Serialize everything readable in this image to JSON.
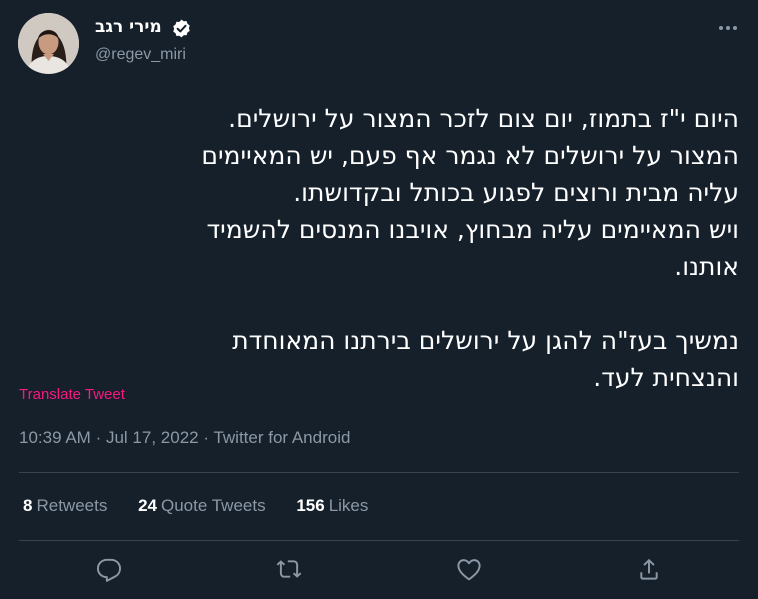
{
  "author": {
    "display_name": "מירי רגב",
    "handle": "@regev_miri",
    "verified": true
  },
  "tweet": {
    "lines": [
      "היום י\"ז בתמוז, יום צום לזכר המצור על ירושלים.",
      "המצור על ירושלים לא נגמר אף פעם, יש המאיימים",
      "עליה מבית ורוצים לפגוע בכותל ובקדושתו.",
      "ויש המאיימים עליה מבחוץ, אויבנו המנסים להשמיד",
      "אותנו.",
      "",
      "נמשיך בעז\"ה להגן על ירושלים בירתנו המאוחדת",
      "והנצחית לעד."
    ],
    "translate_label": "Translate Tweet",
    "time": "10:39 AM",
    "date": "Jul 17, 2022",
    "source": "Twitter for Android",
    "separator": "·"
  },
  "stats": {
    "retweets_count": "8",
    "retweets_label": "Retweets",
    "quote_count": "24",
    "quote_label": "Quote Tweets",
    "likes_count": "156",
    "likes_label": "Likes"
  },
  "icons": {
    "verified": "verified-badge-icon",
    "more": "more-options-icon",
    "reply": "reply-icon",
    "retweet": "retweet-icon",
    "like": "like-icon",
    "share": "share-icon"
  },
  "colors": {
    "background": "#15202b",
    "text": "#ffffff",
    "secondary": "#8b98a5",
    "translate": "#f91880",
    "divider": "#38444d",
    "verified": "#ffffff"
  }
}
